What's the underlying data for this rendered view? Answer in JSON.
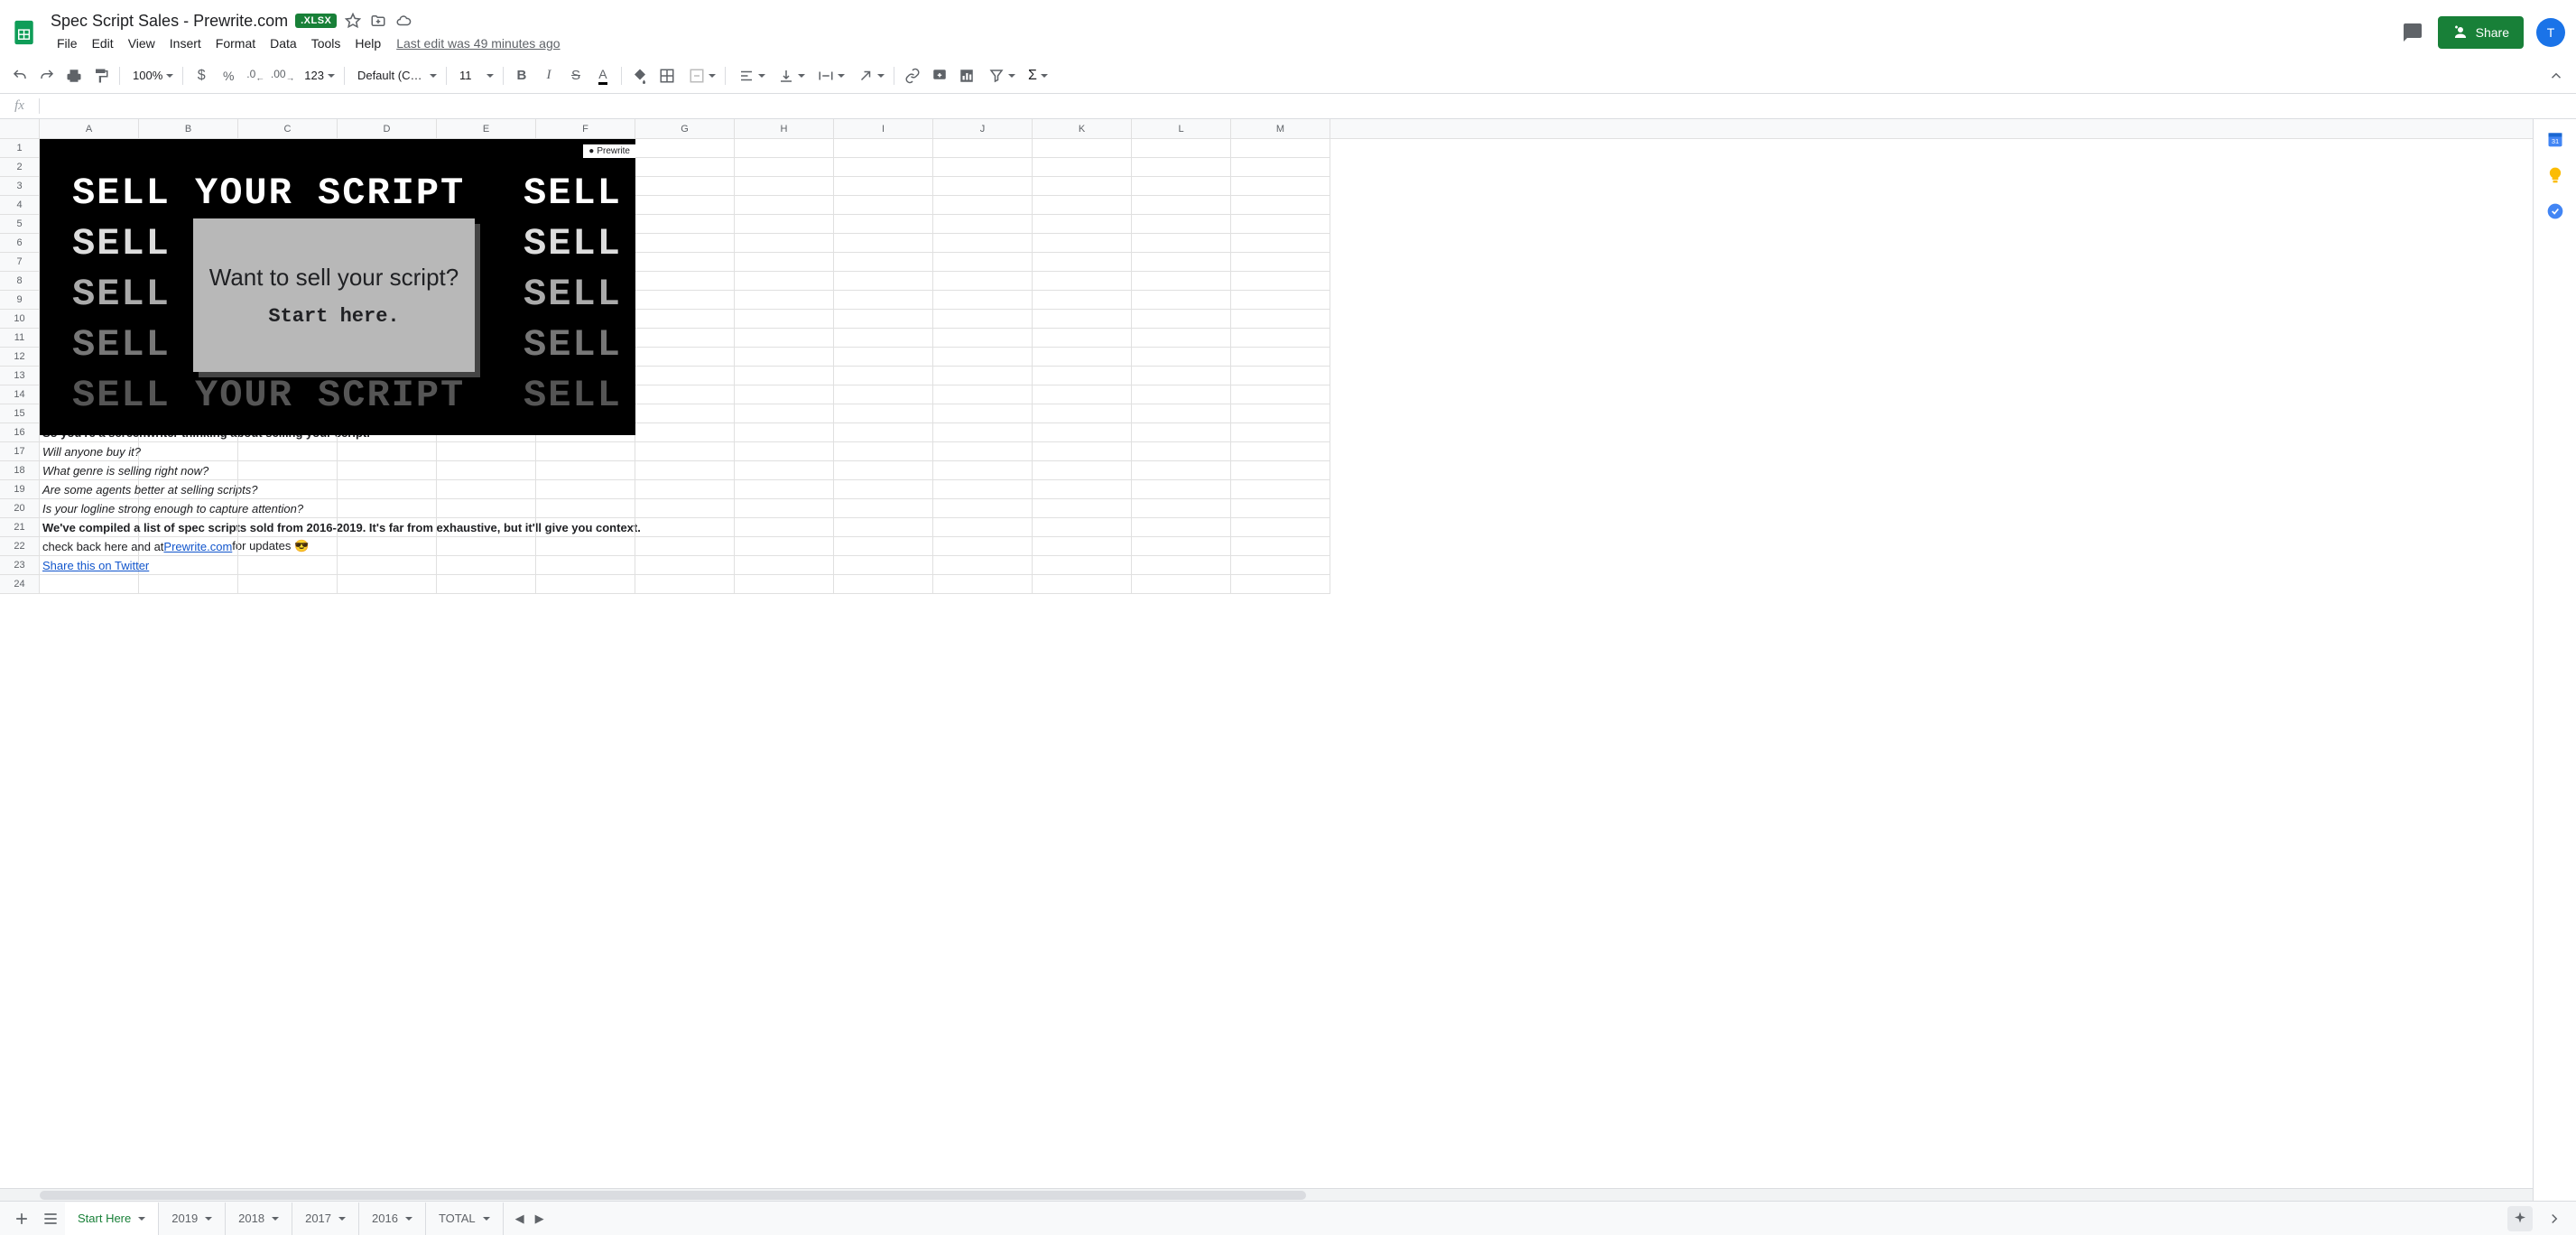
{
  "doc": {
    "title": "Spec Script Sales - Prewrite.com",
    "badge": ".XLSX",
    "last_edit": "Last edit was 49 minutes ago"
  },
  "menu": {
    "file": "File",
    "edit": "Edit",
    "view": "View",
    "insert": "Insert",
    "format": "Format",
    "data": "Data",
    "tools": "Tools",
    "help": "Help"
  },
  "share": {
    "label": "Share",
    "avatar": "T"
  },
  "toolbar": {
    "zoom": "100%",
    "font": "Default (Ca...",
    "size": "11",
    "format_auto": "123"
  },
  "columns": [
    "A",
    "B",
    "C",
    "D",
    "E",
    "F",
    "G",
    "H",
    "I",
    "J",
    "K",
    "L",
    "M"
  ],
  "rows": [
    "1",
    "2",
    "3",
    "4",
    "5",
    "6",
    "7",
    "8",
    "9",
    "10",
    "11",
    "12",
    "13",
    "14",
    "15",
    "16",
    "17",
    "18",
    "19",
    "20",
    "21",
    "22",
    "23",
    "24"
  ],
  "image": {
    "bg_phrase": "SELL YOUR SCRIPT",
    "bg_word": "SELL",
    "center1": "Want to sell your script?",
    "center2": "Start here.",
    "tag": "Prewrite"
  },
  "content": {
    "r16": "So you're a screenwriter thinking about selling your script.",
    "r17": "Will anyone buy it?",
    "r18": "What genre is selling right now?",
    "r19": "Are some agents better at selling scripts?",
    "r20": "Is your logline strong enough to capture attention?",
    "r21": "We've compiled a list of spec scripts sold from 2016-2019. It's far from exhaustive, but it'll give you context.",
    "r22_a": "check back here and at ",
    "r22_link": "Prewrite.com",
    "r22_b": " for updates 😎",
    "r23_link": "Share this on Twitter "
  },
  "tabs": {
    "start": "Start Here",
    "y2019": "2019",
    "y2018": "2018",
    "y2017": "2017",
    "y2016": "2016",
    "total": "TOTAL"
  }
}
